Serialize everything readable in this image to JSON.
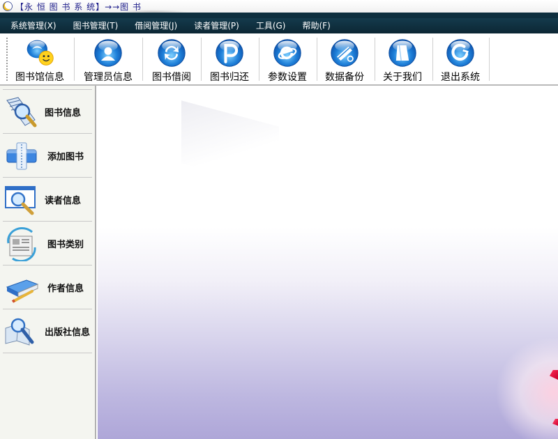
{
  "window": {
    "title": "【永 恒 图 书 系 统】→→图 书"
  },
  "menu": [
    "系统管理(X)",
    "图书管理(T)",
    "借阅管理(J)",
    "读者管理(P)",
    "工具(G)",
    "帮助(F)"
  ],
  "toolbar": [
    {
      "label": "图书馆信息",
      "icon": "library-info-icon"
    },
    {
      "label": "管理员信息",
      "icon": "admin-info-icon"
    },
    {
      "label": "图书借阅",
      "icon": "book-borrow-icon"
    },
    {
      "label": "图书归还",
      "icon": "book-return-icon"
    },
    {
      "label": "参数设置",
      "icon": "settings-icon"
    },
    {
      "label": "数据备份",
      "icon": "backup-icon"
    },
    {
      "label": "关于我们",
      "icon": "about-icon"
    },
    {
      "label": "退出系统",
      "icon": "exit-icon"
    }
  ],
  "sidebar": [
    {
      "label": "图书信息",
      "icon": "book-info-icon"
    },
    {
      "label": "添加图书",
      "icon": "add-book-icon"
    },
    {
      "label": "读者信息",
      "icon": "reader-info-icon"
    },
    {
      "label": "图书类别",
      "icon": "book-category-icon"
    },
    {
      "label": "作者信息",
      "icon": "author-info-icon"
    },
    {
      "label": "出版社信息",
      "icon": "publisher-info-icon"
    }
  ],
  "colors": {
    "menubar": "#0e2f3f",
    "orb_blue": "#1e7fd8",
    "sidebar_bg": "#f4f5f0"
  }
}
